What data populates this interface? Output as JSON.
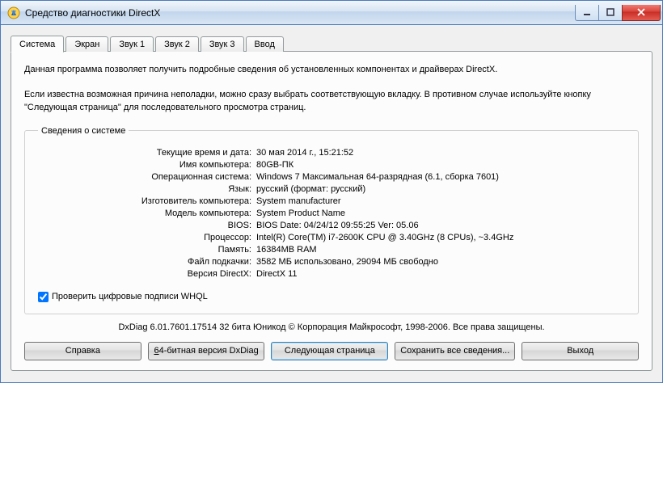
{
  "window": {
    "title": "Средство диагностики DirectX"
  },
  "tabs": [
    {
      "label": "Система"
    },
    {
      "label": "Экран"
    },
    {
      "label": "Звук 1"
    },
    {
      "label": "Звук 2"
    },
    {
      "label": "Звук 3"
    },
    {
      "label": "Ввод"
    }
  ],
  "intro": {
    "p1": "Данная программа позволяет получить подробные сведения об установленных компонентах и драйверах DirectX.",
    "p2": "Если известна возможная причина неполадки, можно сразу выбрать соответствующую вкладку. В противном случае используйте кнопку \"Следующая страница\" для последовательного просмотра страниц."
  },
  "sysinfo": {
    "legend": "Сведения о системе",
    "rows": [
      {
        "label": "Текущие время и дата:",
        "value": "30 мая 2014 г., 15:21:52"
      },
      {
        "label": "Имя компьютера:",
        "value": "80GB-ПК"
      },
      {
        "label": "Операционная система:",
        "value": "Windows 7 Максимальная 64-разрядная (6.1, сборка 7601)"
      },
      {
        "label": "Язык:",
        "value": "русский (формат: русский)"
      },
      {
        "label": "Изготовитель компьютера:",
        "value": "System manufacturer"
      },
      {
        "label": "Модель компьютера:",
        "value": "System Product Name"
      },
      {
        "label": "BIOS:",
        "value": "BIOS Date: 04/24/12 09:55:25 Ver: 05.06"
      },
      {
        "label": "Процессор:",
        "value": "Intel(R) Core(TM) i7-2600K CPU @ 3.40GHz (8 CPUs), ~3.4GHz"
      },
      {
        "label": "Память:",
        "value": "16384MB RAM"
      },
      {
        "label": "Файл подкачки:",
        "value": "3582 МБ использовано, 29094 МБ свободно"
      },
      {
        "label": "Версия DirectX:",
        "value": "DirectX 11"
      }
    ],
    "whql_label": "Проверить цифровые подписи WHQL",
    "whql_checked": true
  },
  "footer": "DxDiag 6.01.7601.17514 32 бита Юникод  © Корпорация Майкрософт, 1998-2006.  Все права защищены.",
  "buttons": {
    "help": "Справка",
    "bit64": "64-битная версия DxDiag",
    "next": "Следующая страница",
    "save": "Сохранить все сведения...",
    "exit": "Выход"
  }
}
